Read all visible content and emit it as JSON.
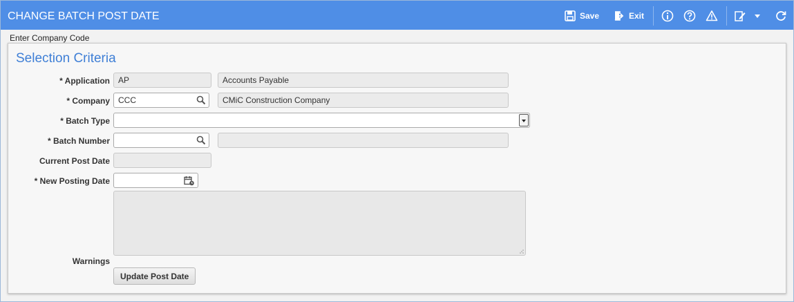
{
  "window": {
    "title": "CHANGE BATCH POST DATE",
    "save_label": "Save",
    "exit_label": "Exit"
  },
  "hint": "Enter Company Code",
  "section": {
    "title": "Selection Criteria"
  },
  "form": {
    "application": {
      "label": "* Application",
      "code": "AP",
      "description": "Accounts Payable"
    },
    "company": {
      "label": "* Company",
      "code": "CCC",
      "description": "CMiC Construction Company"
    },
    "batch_type": {
      "label": "* Batch Type",
      "value": ""
    },
    "batch_number": {
      "label": "* Batch Number",
      "value": "",
      "description": ""
    },
    "current_post_date": {
      "label": "Current Post Date",
      "value": ""
    },
    "new_posting_date": {
      "label": "* New Posting Date",
      "value": ""
    },
    "warnings": {
      "label": "Warnings",
      "value": ""
    }
  },
  "update_button_label": "Update Post Date",
  "icons": {
    "save": "save-icon",
    "exit": "exit-icon",
    "info": "info-icon",
    "help": "help-icon",
    "warning": "warning-icon",
    "edit": "edit-icon",
    "dropdown": "chevron-down-icon",
    "refresh": "refresh-icon",
    "lov": "search-icon",
    "calendar": "calendar-icon"
  },
  "colors": {
    "titlebar": "#4f8ee6",
    "section_title": "#3f7fd6"
  }
}
